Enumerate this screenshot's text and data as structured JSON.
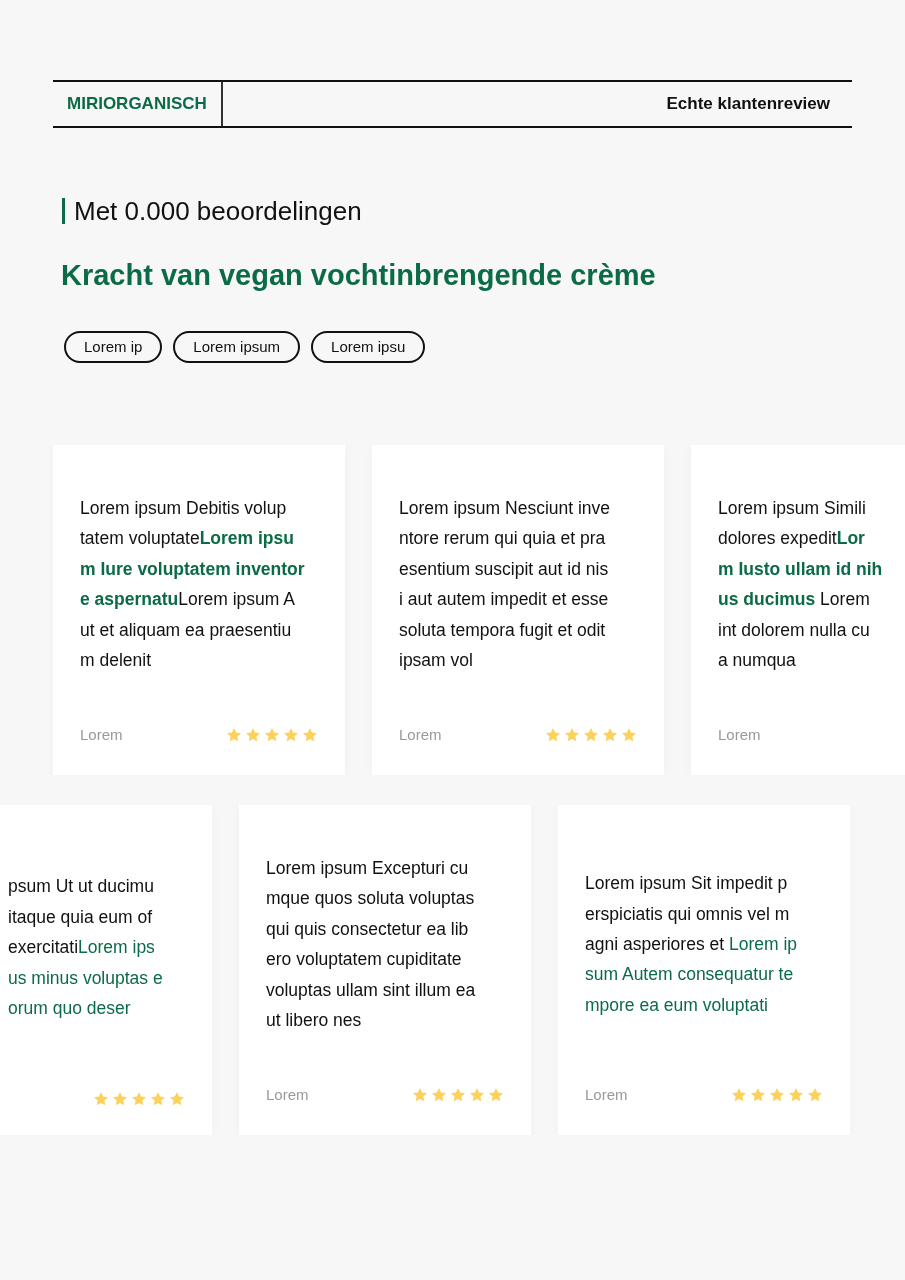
{
  "header": {
    "brand": "MIRIORGANISCH",
    "tagline": "Echte klantenreview"
  },
  "intro": {
    "count_text": "Met 0.000 beoordelingen",
    "title": "Kracht van vegan vochtinbrengende crème",
    "tags": [
      "Lorem ip",
      "Lorem ipsum",
      "Lorem ipsu"
    ]
  },
  "review_rows": [
    {
      "cards": [
        {
          "kind": "full",
          "highlight_bold": true,
          "lines": [
            "Lorem ipsum Debitis volup",
            "tatem voluptate**Lorem ipsu**",
            "**m Iure voluptatem inventor**",
            "**e aspernatu**Lorem ipsum A",
            "ut et aliquam ea praesentiu",
            "m delenit"
          ],
          "author": "Lorem",
          "stars": 5
        },
        {
          "kind": "full",
          "lines": [
            "Lorem ipsum Nesciunt inve",
            "ntore rerum qui quia et pra",
            "esentium suscipit aut id nis",
            "i aut autem impedit et esse",
            "soluta tempora fugit et odit",
            "ipsam vol"
          ],
          "author": "Lorem",
          "stars": 5
        },
        {
          "kind": "cut",
          "highlight_bold": true,
          "lines": [
            "Lorem ipsum Simili",
            "dolores expedit**Lor**",
            "**m Iusto ullam id nih**",
            "**us ducimus** Lorem",
            "int dolorem nulla cu",
            "a numqua"
          ],
          "author": "Lorem"
        }
      ]
    },
    {
      "cards": [
        {
          "kind": "cut",
          "lines": [
            "psum Ut ut ducimu",
            "itaque quia eum of",
            "exercitati**Lorem ips**",
            "**us minus voluptas e**",
            "**orum quo deser**"
          ],
          "stars": 5
        },
        {
          "kind": "full",
          "lines": [
            "Lorem ipsum Excepturi cu",
            "mque quos soluta voluptas",
            "qui quis consectetur ea lib",
            "ero voluptatem cupiditate",
            "voluptas ullam sint illum ea",
            "ut libero nes"
          ],
          "author": "Lorem",
          "stars": 5
        },
        {
          "kind": "full",
          "lines": [
            "Lorem ipsum Sit impedit p",
            "erspiciatis qui omnis vel m",
            "agni asperiores et **Lorem ip**",
            "**sum Autem consequatur te**",
            "**mpore ea eum voluptati**"
          ],
          "author": "Lorem",
          "stars": 5
        }
      ]
    }
  ]
}
